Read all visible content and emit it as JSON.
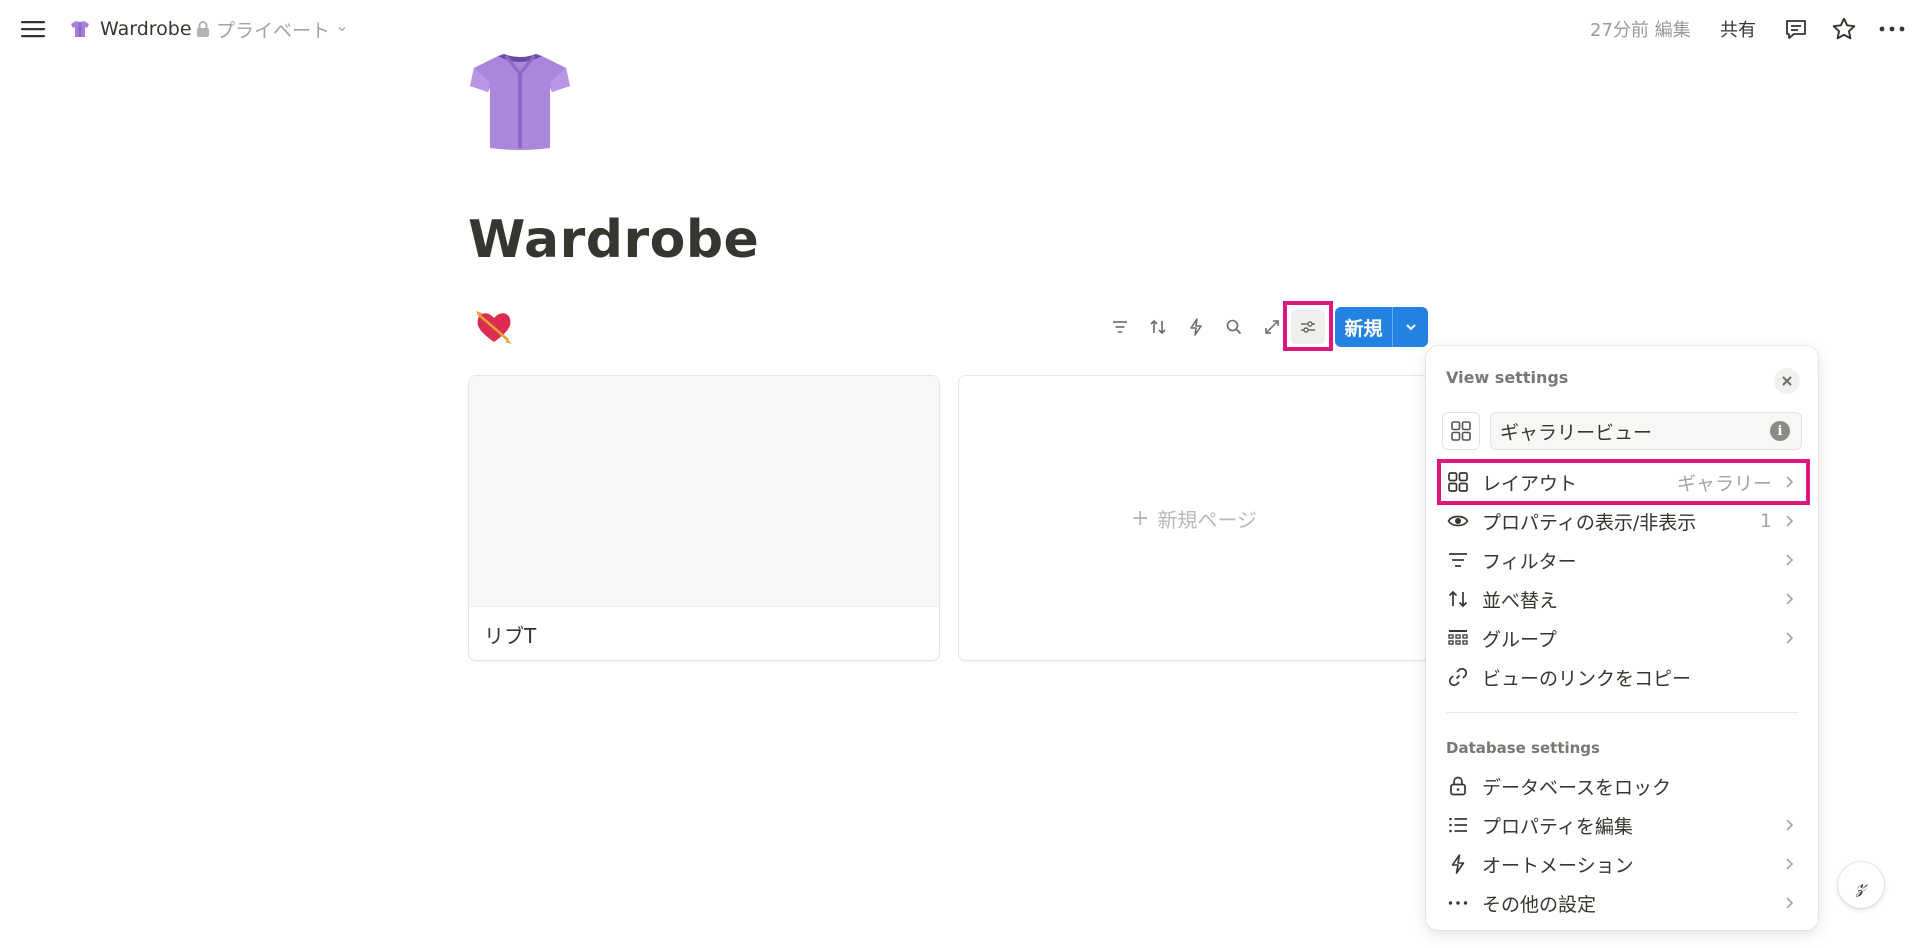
{
  "topbar": {
    "page_title": "Wardrobe",
    "privacy_label": "プライベート",
    "edited_text": "27分前 編集",
    "share_label": "共有"
  },
  "page": {
    "title": "Wardrobe",
    "icon": "purple-shirt-icon"
  },
  "toolbar": {
    "view_icon": "heart-with-arrow-icon",
    "tools": [
      "filter-icon",
      "sort-icon",
      "automation-icon",
      "search-icon",
      "expand-icon",
      "settings-sliders-icon"
    ],
    "new_label": "新規"
  },
  "gallery": {
    "cards": [
      {
        "title": "リブT"
      }
    ],
    "new_page_label": "新規ページ"
  },
  "view_settings": {
    "header": "View settings",
    "view_name": "ギャラリービュー",
    "items": [
      {
        "label": "レイアウト",
        "value": "ギャラリー",
        "icon": "gallery-grid-icon",
        "chevron": true
      },
      {
        "label": "プロパティの表示/非表示",
        "value": "1",
        "icon": "eye-icon",
        "chevron": true
      },
      {
        "label": "フィルター",
        "value": "",
        "icon": "filter-icon",
        "chevron": true
      },
      {
        "label": "並べ替え",
        "value": "",
        "icon": "sort-icon",
        "chevron": true
      },
      {
        "label": "グループ",
        "value": "",
        "icon": "group-icon",
        "chevron": true
      },
      {
        "label": "ビューのリンクをコピー",
        "value": "",
        "icon": "link-icon",
        "chevron": false
      }
    ],
    "database_header": "Database settings",
    "database_items": [
      {
        "label": "データベースをロック",
        "icon": "lock-icon",
        "chevron": false
      },
      {
        "label": "プロパティを編集",
        "icon": "list-icon",
        "chevron": true
      },
      {
        "label": "オートメーション",
        "icon": "automation-icon",
        "chevron": true
      },
      {
        "label": "その他の設定",
        "icon": "more-icon",
        "chevron": true
      }
    ]
  },
  "colors": {
    "accent": "#2383e2",
    "highlight": "#e0167f",
    "text": "#37352f",
    "muted": "#a5a39e"
  }
}
